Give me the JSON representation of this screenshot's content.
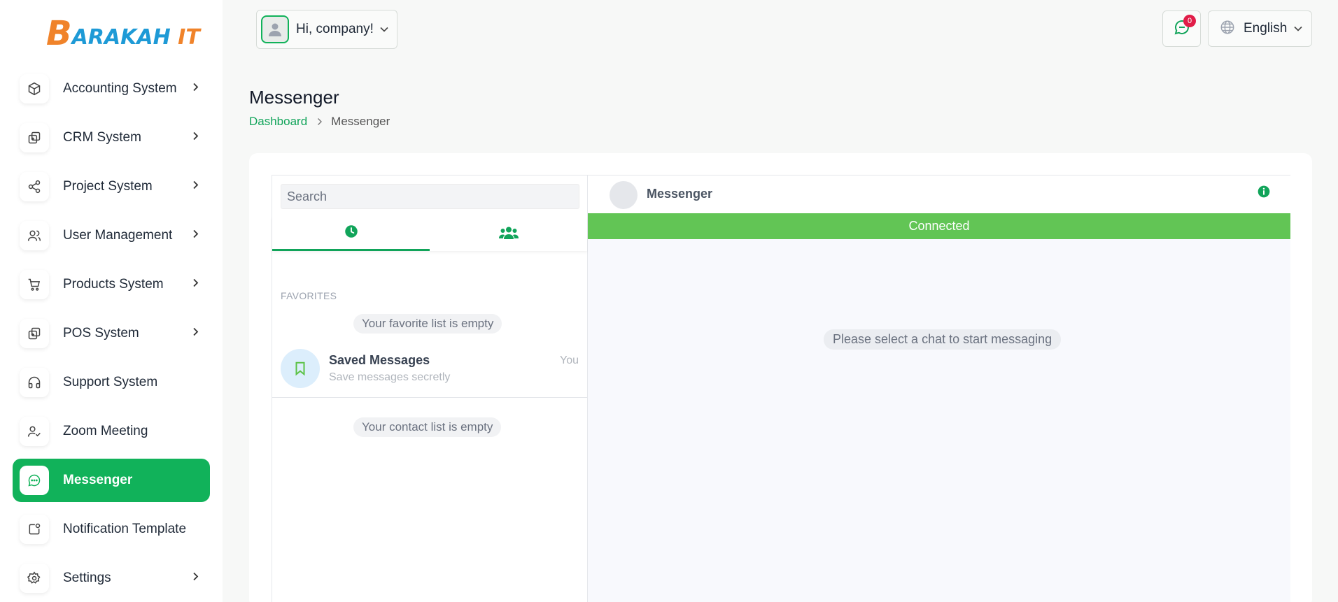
{
  "brand": {
    "logo_letter": "B",
    "logo_text_blue": "ARAKAH",
    "logo_text_orange": "IT"
  },
  "sidebar": {
    "items": [
      {
        "label": "Accounting System",
        "icon": "cube-icon",
        "has_chevron": true
      },
      {
        "label": "CRM System",
        "icon": "layers-icon",
        "has_chevron": true
      },
      {
        "label": "Project System",
        "icon": "share-icon",
        "has_chevron": true
      },
      {
        "label": "User Management",
        "icon": "users-icon",
        "has_chevron": true
      },
      {
        "label": "Products System",
        "icon": "cart-icon",
        "has_chevron": true
      },
      {
        "label": "POS System",
        "icon": "layers-icon",
        "has_chevron": true
      },
      {
        "label": "Support System",
        "icon": "headphones-icon",
        "has_chevron": false
      },
      {
        "label": "Zoom Meeting",
        "icon": "user-check-icon",
        "has_chevron": false
      },
      {
        "label": "Messenger",
        "icon": "message-icon",
        "has_chevron": false,
        "active": true
      },
      {
        "label": "Notification Template",
        "icon": "notification-icon",
        "has_chevron": false
      },
      {
        "label": "Settings",
        "icon": "gear-icon",
        "has_chevron": true
      }
    ]
  },
  "topbar": {
    "greeting": "Hi, company!",
    "notification_count": "0",
    "language": "English"
  },
  "header": {
    "title": "Messenger",
    "breadcrumb": {
      "link": "Dashboard",
      "current": "Messenger"
    }
  },
  "messenger": {
    "search_placeholder": "Search",
    "favorites_label": "FAVORITES",
    "favorites_empty": "Your favorite list is empty",
    "saved": {
      "name": "Saved Messages",
      "subtitle": "Save messages secretly",
      "meta": "You"
    },
    "contacts_empty": "Your contact list is empty",
    "chat_title": "Messenger",
    "status": "Connected",
    "empty_chat": "Please select a chat to start messaging"
  },
  "colors": {
    "accent": "#11b25a",
    "connected": "#62c555",
    "badge": "#e11d48",
    "logo_blue": "#1e9ad6",
    "logo_orange": "#f0832a"
  }
}
